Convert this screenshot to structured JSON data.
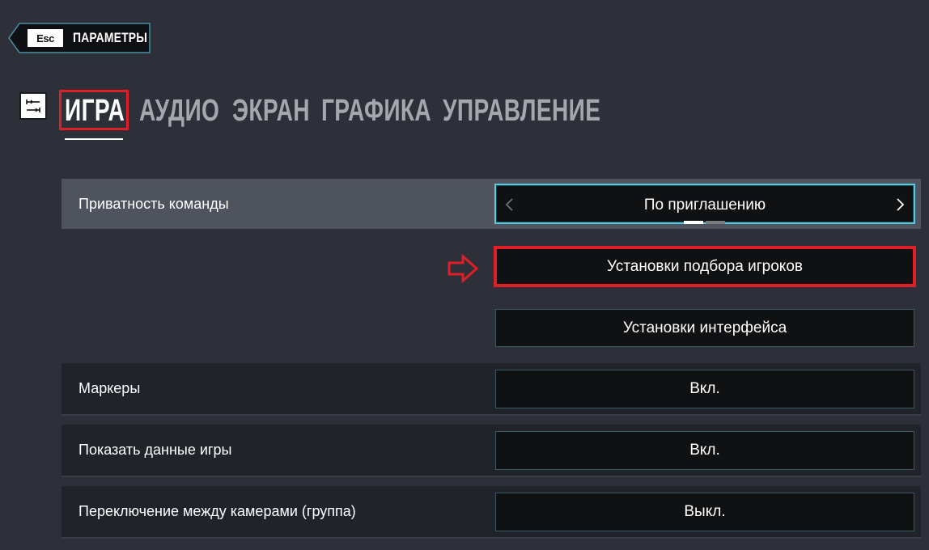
{
  "back": {
    "key": "Esc",
    "label": "ПАРАМЕТРЫ"
  },
  "tabs": [
    {
      "label": "ИГРА",
      "active": true
    },
    {
      "label": "АУДИО",
      "active": false
    },
    {
      "label": "ЭКРАН",
      "active": false
    },
    {
      "label": "ГРАФИКА",
      "active": false
    },
    {
      "label": "УПРАВЛЕНИЕ",
      "active": false
    }
  ],
  "settings": {
    "team_privacy": {
      "label": "Приватность команды",
      "value": "По приглашению",
      "page_count": 2,
      "page_active": 1
    },
    "matchmaking_button": {
      "label": "Установки подбора игроков"
    },
    "interface_button": {
      "label": "Установки интерфейса"
    },
    "markers": {
      "label": "Маркеры",
      "value": "Вкл."
    },
    "show_game_data": {
      "label": "Показать данные игры",
      "value": "Вкл."
    },
    "camera_switch": {
      "label": "Переключение между камерами (группа)",
      "value": "Выкл."
    }
  },
  "colors": {
    "background": "#2d3039",
    "highlight_red": "#e01e25",
    "focus_cyan": "#5ec8e0"
  },
  "icons": {
    "tab_icon": "settings-sliders-icon",
    "prev": "chevron-left-icon",
    "next": "chevron-right-icon",
    "arrow": "arrow-right-outline-icon"
  }
}
